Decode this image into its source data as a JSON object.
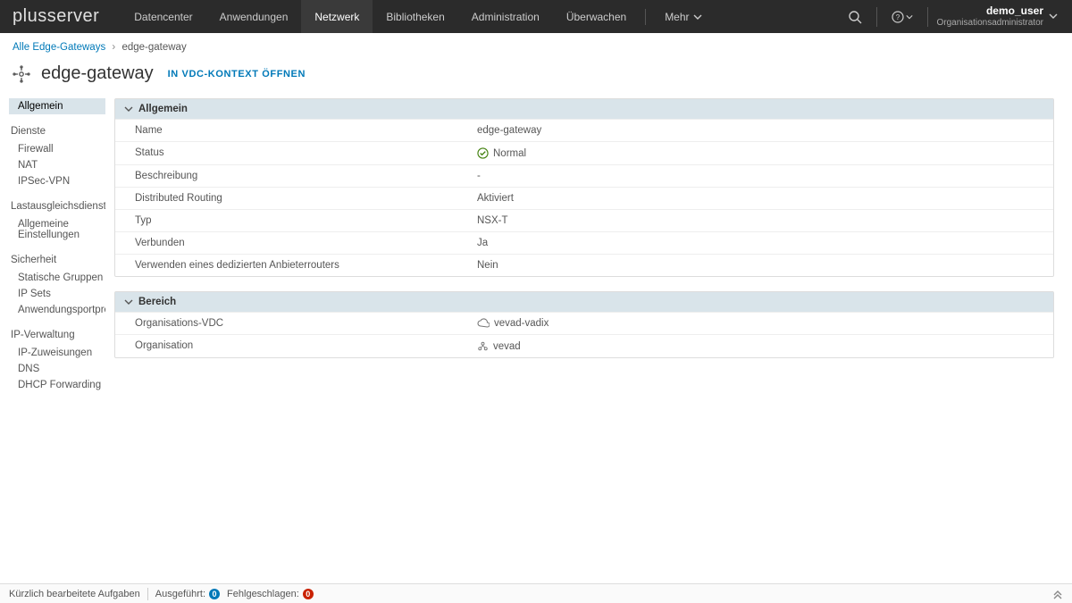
{
  "brand": "plusserver",
  "topnav": {
    "items": [
      "Datencenter",
      "Anwendungen",
      "Netzwerk",
      "Bibliotheken",
      "Administration",
      "Überwachen"
    ],
    "more": "Mehr",
    "active_index": 2
  },
  "user": {
    "name": "demo_user",
    "role": "Organisationsadministrator"
  },
  "breadcrumb": {
    "root": "Alle Edge-Gateways",
    "current": "edge-gateway"
  },
  "page": {
    "title": "edge-gateway",
    "vdc_link": "IN VDC-KONTEXT ÖFFNEN"
  },
  "sidebar": {
    "sections": [
      {
        "heading": null,
        "items": [
          "Allgemein"
        ],
        "selected": 0
      },
      {
        "heading": "Dienste",
        "items": [
          "Firewall",
          "NAT",
          "IPSec-VPN"
        ]
      },
      {
        "heading": "Lastausgleichsdienst",
        "items": [
          "Allgemeine Einstellungen"
        ]
      },
      {
        "heading": "Sicherheit",
        "items": [
          "Statische Gruppen",
          "IP Sets",
          "Anwendungsportprofile"
        ]
      },
      {
        "heading": "IP-Verwaltung",
        "items": [
          "IP-Zuweisungen",
          "DNS",
          "DHCP Forwarding"
        ]
      }
    ]
  },
  "panels": {
    "general": {
      "title": "Allgemein",
      "rows": [
        {
          "k": "Name",
          "v": "edge-gateway"
        },
        {
          "k": "Status",
          "v": "Normal",
          "icon": "ok"
        },
        {
          "k": "Beschreibung",
          "v": "-"
        },
        {
          "k": "Distributed Routing",
          "v": "Aktiviert"
        },
        {
          "k": "Typ",
          "v": "NSX-T"
        },
        {
          "k": "Verbunden",
          "v": "Ja"
        },
        {
          "k": "Verwenden eines dedizierten Anbieterrouters",
          "v": "Nein"
        }
      ]
    },
    "scope": {
      "title": "Bereich",
      "rows": [
        {
          "k": "Organisations-VDC",
          "v": "vevad-vadix",
          "icon": "cloud"
        },
        {
          "k": "Organisation",
          "v": "vevad",
          "icon": "org"
        }
      ]
    }
  },
  "footer": {
    "recent": "Kürzlich bearbeitete Aufgaben",
    "running_label": "Ausgeführt:",
    "running_count": "0",
    "failed_label": "Fehlgeschlagen:",
    "failed_count": "0"
  }
}
